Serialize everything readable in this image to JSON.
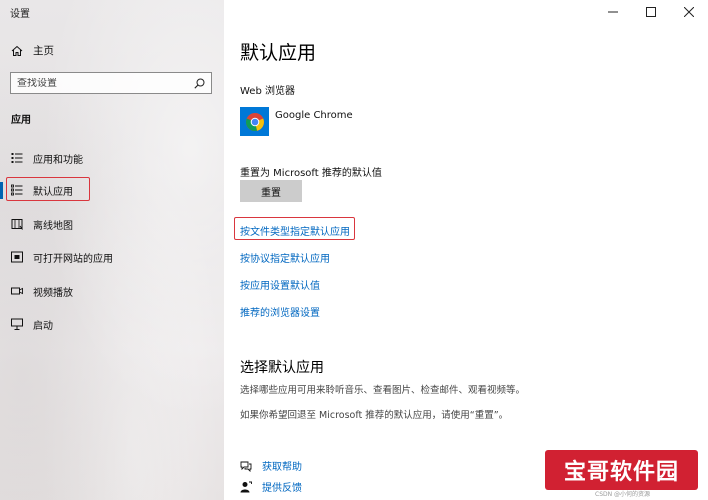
{
  "window": {
    "title": "设置"
  },
  "sidebar": {
    "home_label": "主页",
    "search_placeholder": "查找设置",
    "section_label": "应用",
    "items": [
      {
        "label": "应用和功能",
        "icon": "apps-list-icon",
        "active": false
      },
      {
        "label": "默认应用",
        "icon": "default-apps-icon",
        "active": true
      },
      {
        "label": "离线地图",
        "icon": "offline-maps-icon",
        "active": false
      },
      {
        "label": "可打开网站的应用",
        "icon": "apps-for-websites-icon",
        "active": false
      },
      {
        "label": "视频播放",
        "icon": "video-playback-icon",
        "active": false
      },
      {
        "label": "启动",
        "icon": "startup-icon",
        "active": false
      }
    ]
  },
  "main": {
    "title": "默认应用",
    "web_browser_label": "Web 浏览器",
    "browser_name": "Google Chrome",
    "reset_label": "重置为 Microsoft 推荐的默认值",
    "reset_button": "重置",
    "links": [
      "按文件类型指定默认应用",
      "按协议指定默认应用",
      "按应用设置默认值",
      "推荐的浏览器设置"
    ],
    "choose_title": "选择默认应用",
    "choose_desc": "选择哪些应用可用来聆听音乐、查看图片、检查邮件、观看视频等。",
    "reset_note": "如果你希望回退至 Microsoft 推荐的默认应用，请使用“重置”。",
    "help": [
      {
        "label": "获取帮助",
        "icon": "help-chat-icon"
      },
      {
        "label": "提供反馈",
        "icon": "feedback-icon"
      }
    ]
  },
  "watermark": {
    "logo_text": "宝哥软件园",
    "caption": "CSDN @小何的资源"
  },
  "colors": {
    "accent": "#0063b1",
    "link": "#0067c0",
    "highlight_box": "#d9363e",
    "watermark": "#cd1022"
  }
}
